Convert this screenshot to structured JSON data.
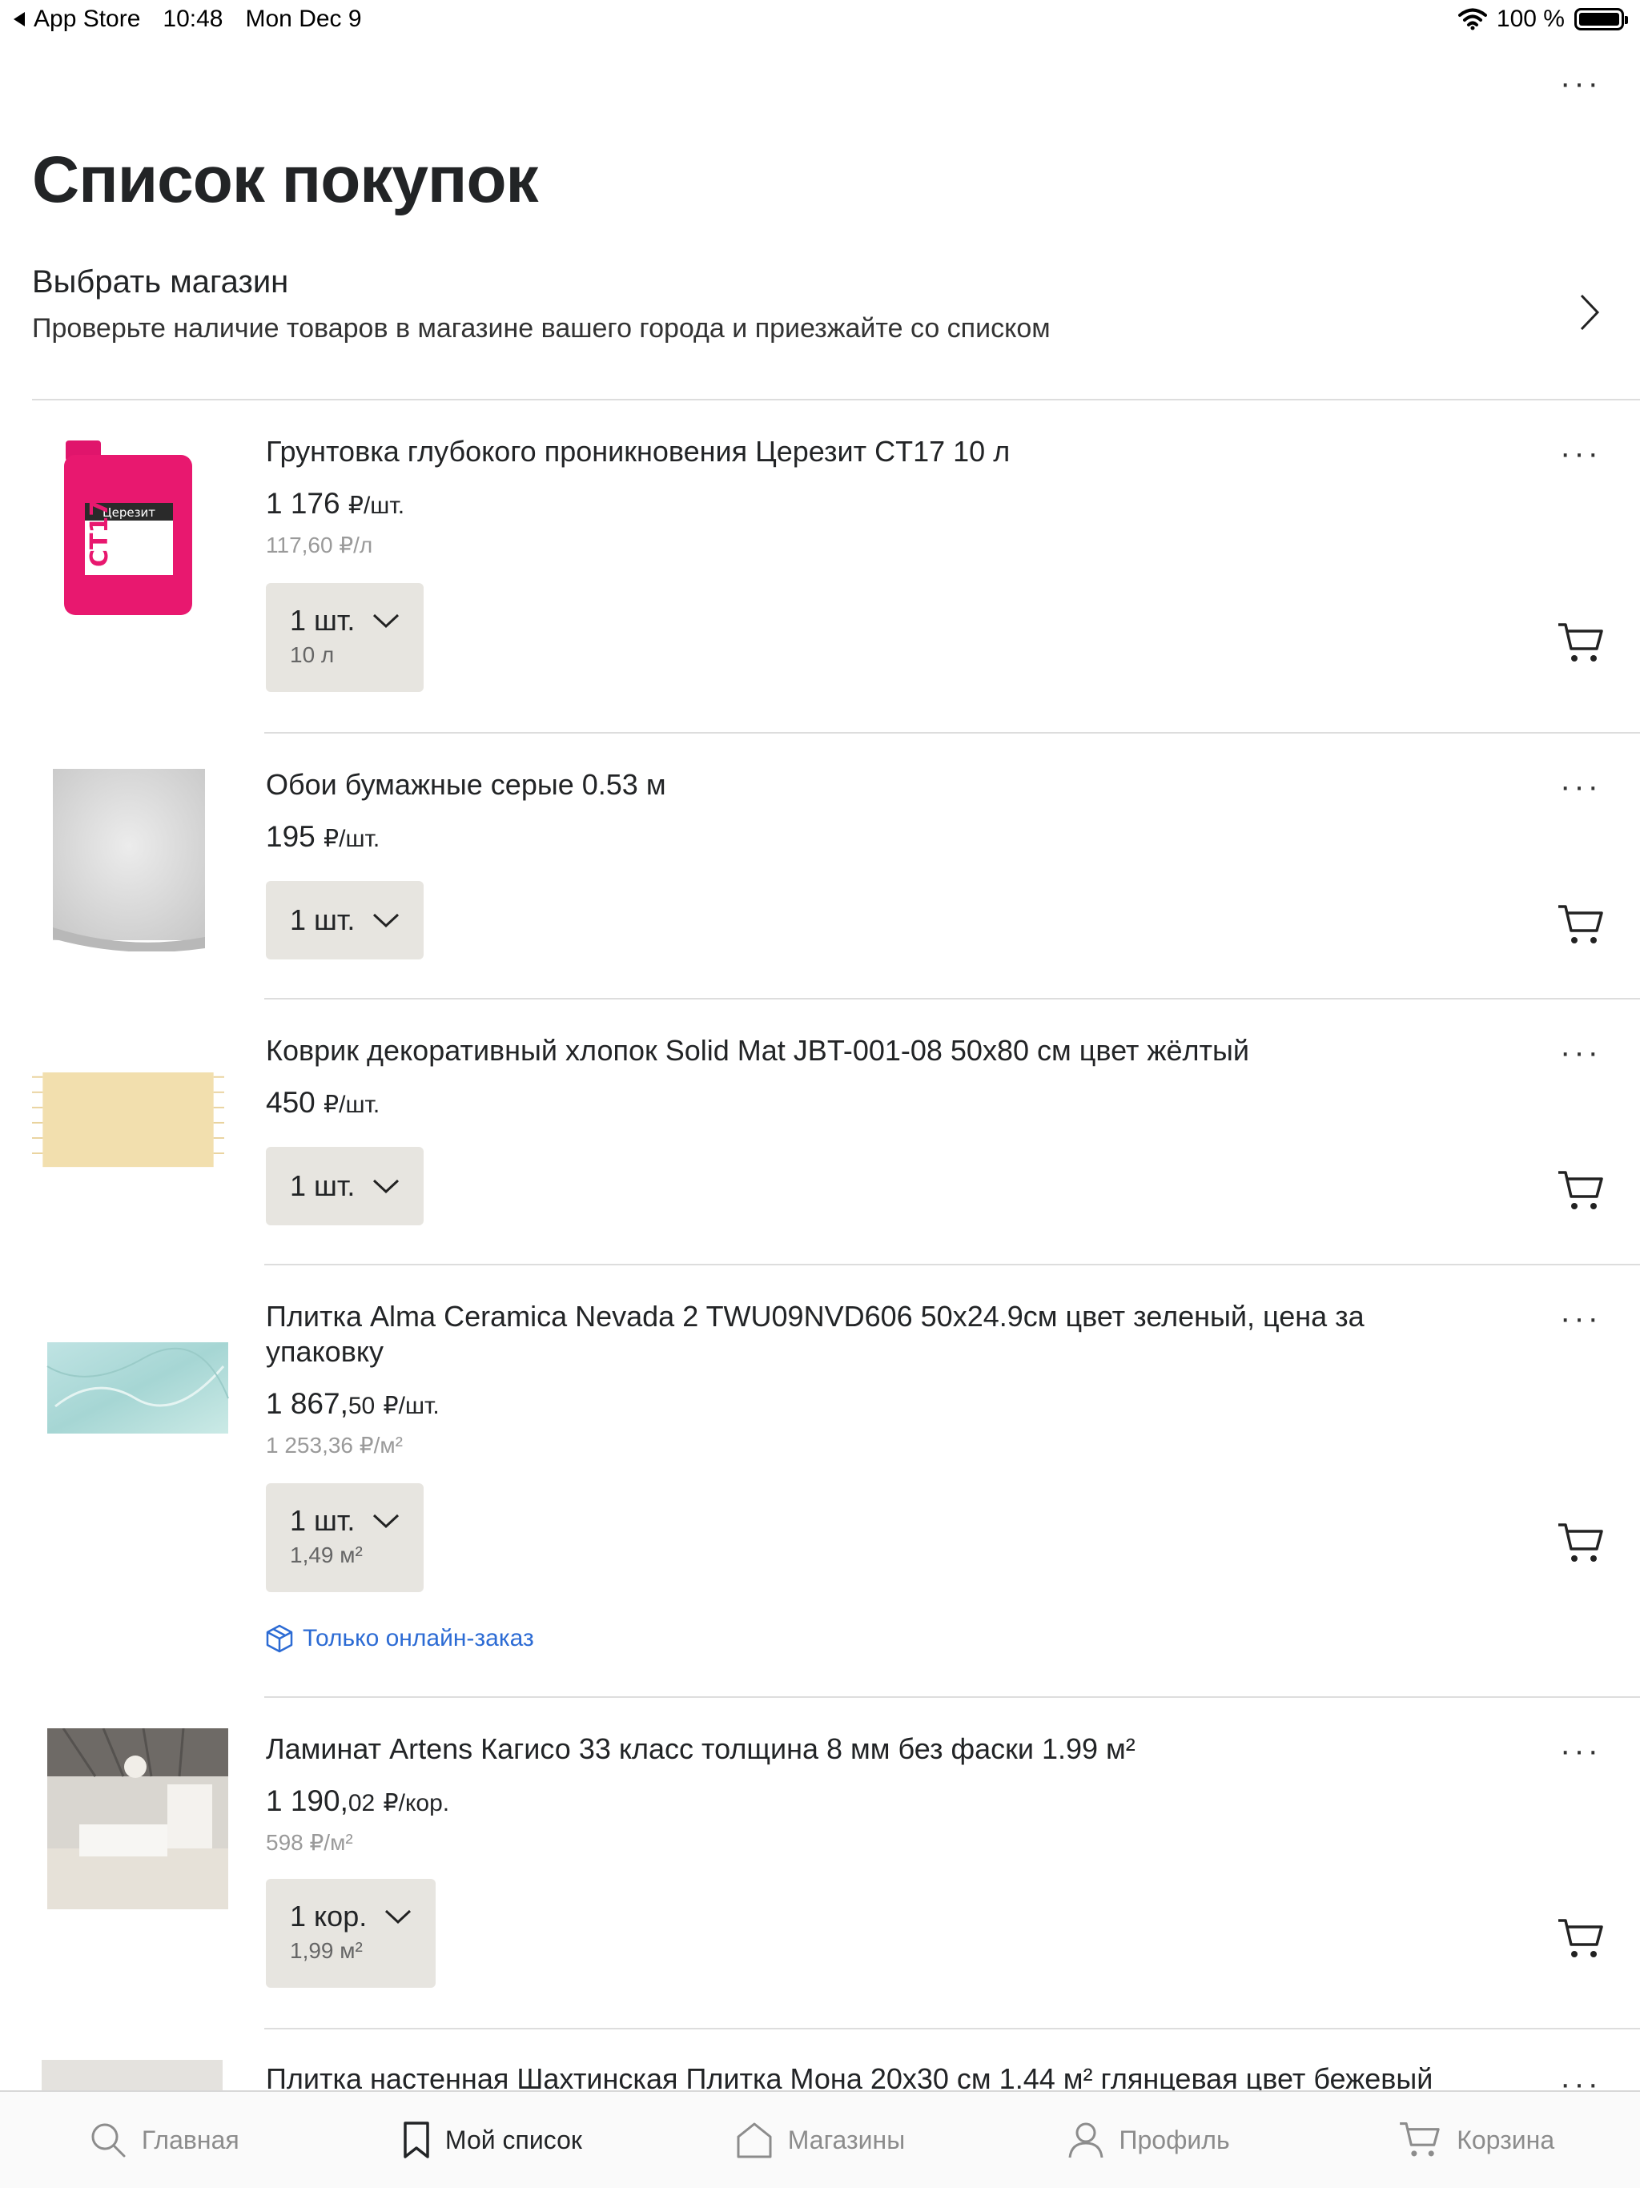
{
  "status_bar": {
    "back_label": "App Store",
    "time": "10:48",
    "date": "Mon Dec 9",
    "battery": "100 %"
  },
  "header": {
    "title": "Список покупок",
    "more_icon": "ellipsis-icon"
  },
  "store_picker": {
    "title": "Выбрать магазин",
    "subtitle": "Проверьте наличие товаров в магазине вашего города и приезжайте со списком"
  },
  "items": [
    {
      "name": "Грунтовка глубокого проникновения Церезит CT17 10 л",
      "price": "1 176",
      "price_unit": "₽/шт.",
      "unit_price": "117,60 ₽/л",
      "qty": "1 шт.",
      "qty_sub": "10 л"
    },
    {
      "name": "Обои бумажные серые 0.53 м",
      "price": "195",
      "price_unit": "₽/шт.",
      "qty": "1 шт."
    },
    {
      "name": "Коврик декоративный хлопок Solid Mat JBT-001-08 50x80 см цвет жёлтый",
      "price": "450",
      "price_unit": "₽/шт.",
      "qty": "1 шт."
    },
    {
      "name": "Плитка Alma Ceramica Nevada 2 TWU09NVD606 50x24.9см цвет зеленый, цена за упаковку",
      "price": "1 867,",
      "price_kop": "50",
      "price_unit": "₽/шт.",
      "unit_price": "1 253,36 ₽/м²",
      "qty": "1 шт.",
      "qty_sub": "1,49 м²",
      "online_note": "Только онлайн-заказ"
    },
    {
      "name": "Ламинат Artens Кагисо 33 класс толщина 8 мм без фаски 1.99 м²",
      "price": "1 190,",
      "price_kop": "02",
      "price_unit": "₽/кор.",
      "unit_price": "598 ₽/м²",
      "qty": "1 кор.",
      "qty_sub": "1,99 м²"
    },
    {
      "name": "Плитка настенная Шахтинская Плитка Мона 20x30 см 1.44 м² глянцевая цвет бежевый"
    }
  ],
  "tabbar": {
    "tabs": [
      {
        "label": "Главная",
        "icon": "search-icon"
      },
      {
        "label": "Мой список",
        "icon": "bookmark-icon"
      },
      {
        "label": "Магазины",
        "icon": "house-icon"
      },
      {
        "label": "Профиль",
        "icon": "person-icon"
      },
      {
        "label": "Корзина",
        "icon": "cart-icon"
      }
    ],
    "active": "Мой список"
  },
  "colors": {
    "text": "#222426",
    "divider": "#dddddd",
    "qty_bg": "#e7e5e0",
    "link": "#2c6bd4",
    "muted": "#9a9a9a"
  }
}
